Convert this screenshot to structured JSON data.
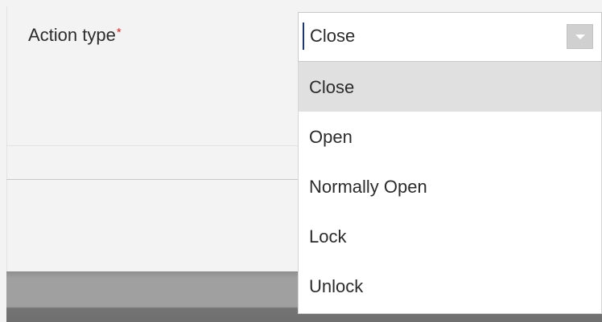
{
  "field": {
    "label": "Action type",
    "required_marker": "*",
    "value": "Close"
  },
  "dropdown": {
    "options": [
      {
        "label": "Close",
        "selected": true
      },
      {
        "label": "Open",
        "selected": false
      },
      {
        "label": "Normally Open",
        "selected": false
      },
      {
        "label": "Lock",
        "selected": false
      },
      {
        "label": "Unlock",
        "selected": false
      }
    ]
  },
  "icons": {
    "dropdown_arrow": "chevron-down-icon"
  },
  "colors": {
    "required": "#d42424",
    "selected_option_bg": "#e0e0e0",
    "caret": "#1d3870"
  }
}
